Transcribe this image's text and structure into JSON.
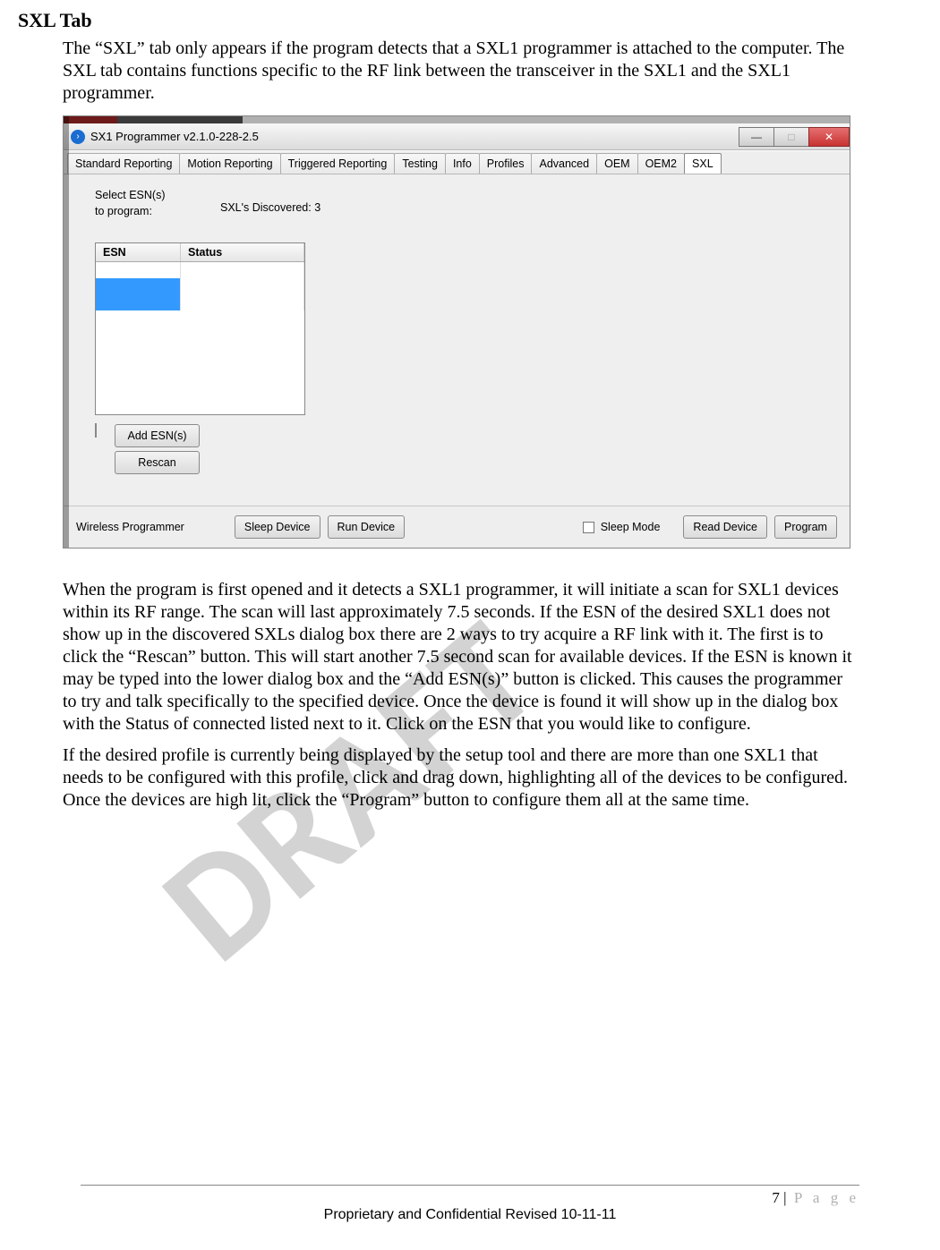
{
  "heading": "SXL Tab",
  "para1": "The “SXL” tab only appears if the program detects that a SXL1 programmer is attached to the computer. The SXL tab contains functions specific to the RF link between the transceiver in the SXL1 and the SXL1 programmer.",
  "screenshot": {
    "title": "SX1 Programmer v2.1.0-228-2.5",
    "tabs": [
      "Standard Reporting",
      "Motion Reporting",
      "Triggered Reporting",
      "Testing",
      "Info",
      "Profiles",
      "Advanced",
      "OEM",
      "OEM2",
      "SXL"
    ],
    "active_tab": "SXL",
    "select_label_line1": "Select ESN(s)",
    "select_label_line2": "to program:",
    "discovered_label": "SXL's Discovered: 3",
    "col_esn": "ESN",
    "col_status": "Status",
    "add_btn": "Add ESN(s)",
    "rescan_btn": "Rescan",
    "bottom_label": "Wireless Programmer",
    "sleep_device_btn": "Sleep Device",
    "run_device_btn": "Run Device",
    "sleep_mode_label": "Sleep Mode",
    "read_device_btn": "Read Device",
    "program_btn": "Program"
  },
  "watermark": "DRAFT",
  "para2": "When the program is first opened and it detects a SXL1 programmer, it will initiate a scan for SXL1 devices within its RF range. The scan will last approximately 7.5 seconds. If the ESN of the desired SXL1 does not show up in the discovered SXLs dialog box there are 2 ways to try acquire a RF link with it. The first is to click the “Rescan” button. This will start another 7.5 second scan for available devices. If the ESN is known it may be typed into the lower dialog box and the “Add ESN(s)” button is clicked. This causes the programmer to try and talk specifically to the specified device. Once the device is found it will show up in the dialog box with the Status of connected listed next to it. Click on the ESN that you would like to configure.",
  "para3": "If the desired profile is currently being displayed by the setup tool  and there are more than one SXL1 that needs to be configured with this profile, click and drag down, highlighting all of the devices to be configured. Once the devices are high lit, click the “Program” button to configure them all at the same time.",
  "footer": {
    "page_num": "7",
    "page_word": "P a g e",
    "separator": "|",
    "line2": "Proprietary and Confidential Revised 10-11-11"
  }
}
